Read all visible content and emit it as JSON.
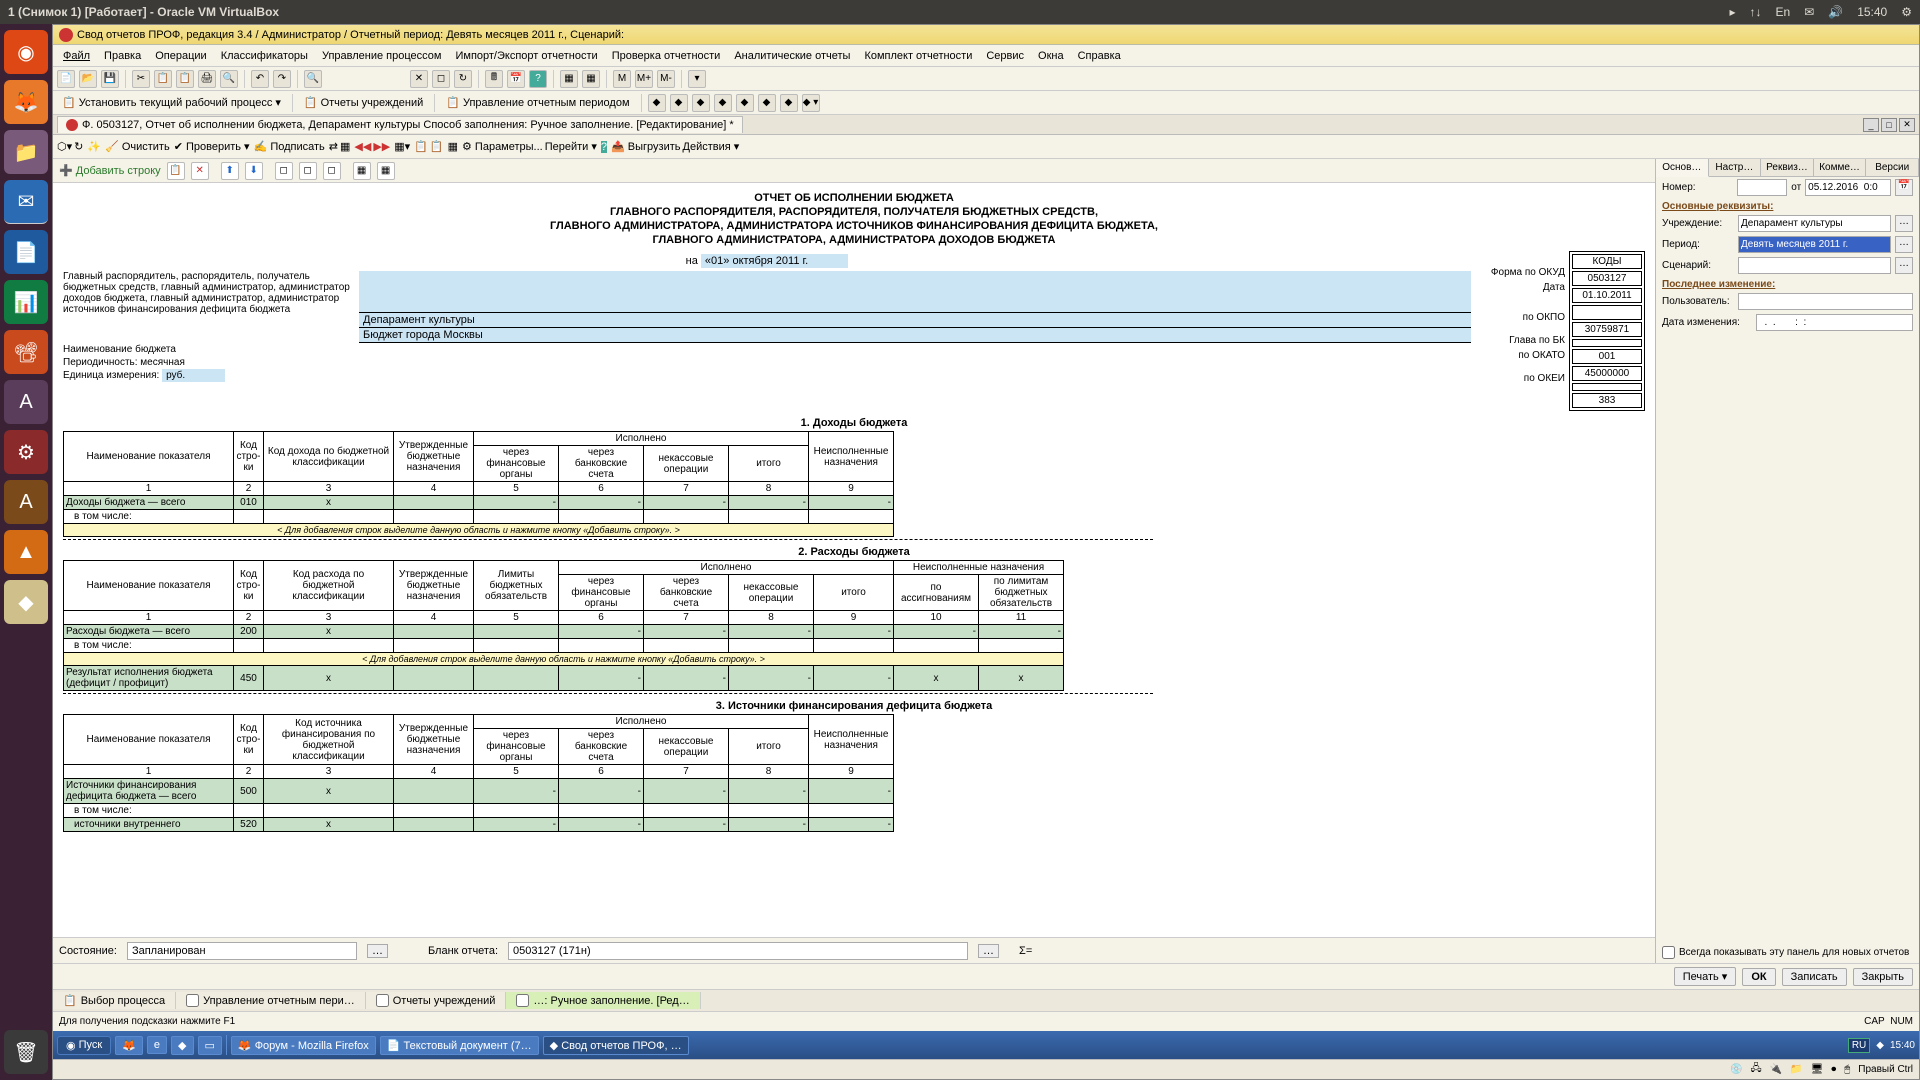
{
  "topbar": {
    "title": "1 (Снимок 1) [Работает] - Oracle VM VirtualBox",
    "time": "15:40",
    "lang": "En"
  },
  "vm_title": "Свод отчетов ПРОФ, редакция 3.4 / Администратор / Отчетный период: Девять месяцев 2011 г., Сценарий:",
  "menu": [
    "Файл",
    "Правка",
    "Операции",
    "Классификаторы",
    "Управление процессом",
    "Импорт/Экспорт отчетности",
    "Проверка отчетности",
    "Аналитические отчеты",
    "Комплект отчетности",
    "Сервис",
    "Окна",
    "Справка"
  ],
  "tb_labels": {
    "set_process": "Установить текущий рабочий процесс",
    "inst_reports": "Отчеты учреждений",
    "period_mgmt": "Управление отчетным периодом"
  },
  "tab_title": "Ф. 0503127, Отчет об исполнении бюджета, Депарамент культуры Способ заполнения: Ручное заполнение. [Редактирование] *",
  "tb2": {
    "clear": "Очистить",
    "check": "Проверить",
    "sign": "Подписать",
    "params": "Параметры...",
    "goto": "Перейти",
    "upload": "Выгрузить",
    "actions": "Действия"
  },
  "add_row": "Добавить строку",
  "report": {
    "title1": "ОТЧЕТ ОБ ИСПОЛНЕНИИ БЮДЖЕТА",
    "title2": "ГЛАВНОГО РАСПОРЯДИТЕЛЯ, РАСПОРЯДИТЕЛЯ, ПОЛУЧАТЕЛЯ БЮДЖЕТНЫХ СРЕДСТВ,",
    "title3": "ГЛАВНОГО АДМИНИСТРАТОРА, АДМИНИСТРАТОРА ИСТОЧНИКОВ ФИНАНСИРОВАНИЯ ДЕФИЦИТА БЮДЖЕТА,",
    "title4": "ГЛАВНОГО АДМИНИСТРАТОРА, АДМИНИСТРАТОРА ДОХОДОВ БЮДЖЕТА",
    "on_date_label": "на",
    "on_date": "«01» октября 2011 г.",
    "codes_hdr": "КОДЫ",
    "okud_label": "Форма по ОКУД",
    "okud": "0503127",
    "date_label": "Дата",
    "date": "01.10.2011",
    "okpo_label": "по ОКПО",
    "okpo": "30759871",
    "bk_label": "Глава по БК",
    "bk": "001",
    "okato_label": "по ОКАТО",
    "okato": "45000000",
    "okei_label": "по ОКЕИ",
    "okei": "383",
    "recipient_label": "Главный распорядитель, распорядитель, получатель бюджетных средств, главный администратор, администратор доходов бюджета, главный администратор, администратор источников финансирования дефицита бюджета",
    "recipient": "Депарамент культуры",
    "budget_label": "Наименование бюджета",
    "budget": "Бюджет города Москвы",
    "period_label": "Периодичность: месячная",
    "unit_label": "Единица измерения:",
    "unit": "руб."
  },
  "sec1": {
    "title": "1. Доходы бюджета",
    "h": [
      "Наименование показателя",
      "Код стро-ки",
      "Код дохода по бюджетной классификации",
      "Утвержденные бюджетные назначения",
      "через финансовые органы",
      "через банковские счета",
      "некассовые операции",
      "итого",
      "Неисполненные назначения"
    ],
    "exec": "Исполнено",
    "nums": [
      "1",
      "2",
      "3",
      "4",
      "5",
      "6",
      "7",
      "8",
      "9"
    ],
    "row1": [
      "Доходы бюджета — всего",
      "010",
      "x",
      "",
      "-",
      "-",
      "-",
      "-",
      "-"
    ],
    "row2": "в том числе:",
    "hint": "< Для добавления строк выделите данную область и нажмите кнопку «Добавить строку». >"
  },
  "sec2": {
    "title": "2. Расходы бюджета",
    "h": [
      "Наименование показателя",
      "Код стро-ки",
      "Код расхода по бюджетной классификации",
      "Утвержденные бюджетные назначения",
      "Лимиты бюджетных обязательств",
      "через финансовые органы",
      "через банковские счета",
      "некассовые операции",
      "итого",
      "по ассигнованиям",
      "по лимитам бюджетных обязательств"
    ],
    "exec": "Исполнено",
    "unexec": "Неисполненные назначения",
    "nums": [
      "1",
      "2",
      "3",
      "4",
      "5",
      "6",
      "7",
      "8",
      "9",
      "10",
      "11"
    ],
    "row1": [
      "Расходы бюджета — всего",
      "200",
      "x",
      "",
      "",
      "-",
      "-",
      "-",
      "-",
      "-",
      "-"
    ],
    "row2": "в том числе:",
    "hint": "< Для добавления строк выделите данную область и нажмите кнопку «Добавить строку». >",
    "row3": [
      "Результат исполнения бюджета (дефицит / профицит)",
      "450",
      "x",
      "",
      "",
      "-",
      "-",
      "-",
      "-",
      "x",
      "x"
    ]
  },
  "sec3": {
    "title": "3. Источники финансирования дефицита бюджета",
    "h": [
      "Наименование показателя",
      "Код стро-ки",
      "Код источника финансирования по бюджетной классификации",
      "Утвержденные бюджетные назначения",
      "через финансовые органы",
      "через банковские счета",
      "некассовые операции",
      "итого",
      "Неисполненные назначения"
    ],
    "exec": "Исполнено",
    "nums": [
      "1",
      "2",
      "3",
      "4",
      "5",
      "6",
      "7",
      "8",
      "9"
    ],
    "row1": [
      "Источники финансирования дефицита бюджета — всего",
      "500",
      "x",
      "",
      "-",
      "-",
      "-",
      "-",
      "-"
    ],
    "row2": "в том числе:",
    "row3": [
      "источники внутреннего",
      "520",
      "x",
      "",
      "-",
      "-",
      "-",
      "-",
      "-"
    ]
  },
  "side": {
    "tabs": [
      "Основ…",
      "Настр…",
      "Реквиз…",
      "Комме…",
      "Версии"
    ],
    "number_label": "Номер:",
    "from": "от",
    "date": "05.12.2016  0:0",
    "grp1": "Основные реквизиты:",
    "institution_label": "Учреждение:",
    "institution": "Депарамент культуры",
    "period_label": "Период:",
    "period": "Девять месяцев 2011 г.",
    "scenario_label": "Сценарий:",
    "grp2": "Последнее изменение:",
    "user_label": "Пользователь:",
    "changed_label": "Дата изменения:",
    "changed": "  .  .       :  :",
    "always_show": "Всегда показывать эту панель для новых отчетов"
  },
  "status": {
    "state_label": "Состояние:",
    "state": "Запланирован",
    "blank_label": "Бланк отчета:",
    "blank": "0503127 (171н)",
    "sigma": "Σ="
  },
  "footer": {
    "print": "Печать",
    "ok": "ОК",
    "save": "Записать",
    "close": "Закрыть"
  },
  "wintabs": [
    "Выбор процесса",
    "Управление отчетным пери…",
    "Отчеты учреждений",
    "…: Ручное заполнение. [Ред…"
  ],
  "hint_text": "Для получения подсказки нажмите F1",
  "caps": "CAP",
  "num": "NUM",
  "taskbar": {
    "start": "Пуск",
    "btns": [
      "Форум - Mozilla Firefox",
      "Текстовый документ (7…",
      "Свод отчетов ПРОФ, …"
    ],
    "lang": "RU",
    "time": "15:40"
  },
  "vm_status": "Правый Ctrl"
}
